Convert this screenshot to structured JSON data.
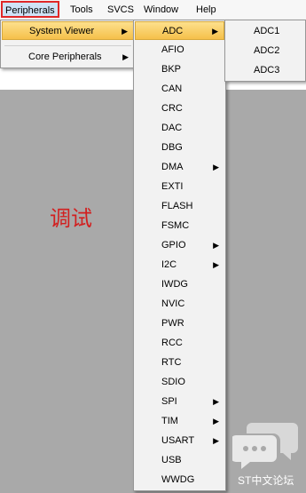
{
  "menubar": {
    "items": [
      "Peripherals",
      "Tools",
      "SVCS",
      "Window",
      "Help"
    ]
  },
  "peripherals_menu": {
    "system_viewer": "System Viewer",
    "core_peripherals": "Core Peripherals"
  },
  "system_viewer_menu": {
    "items": [
      "ADC",
      "AFIO",
      "BKP",
      "CAN",
      "CRC",
      "DAC",
      "DBG",
      "DMA",
      "EXTI",
      "FLASH",
      "FSMC",
      "GPIO",
      "I2C",
      "IWDG",
      "NVIC",
      "PWR",
      "RCC",
      "RTC",
      "SDIO",
      "SPI",
      "TIM",
      "USART",
      "USB",
      "WWDG"
    ]
  },
  "adc_menu": {
    "items": [
      "ADC1",
      "ADC2",
      "ADC3"
    ]
  },
  "annotation": "调试",
  "logo_text": "ST中文论坛"
}
